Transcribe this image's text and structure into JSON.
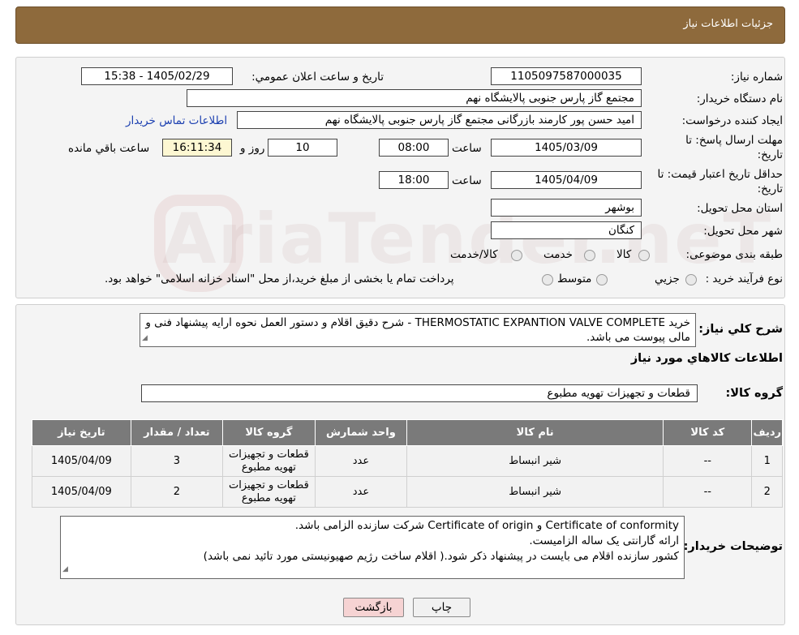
{
  "header": {
    "title": "جزئیات اطلاعات نیاز"
  },
  "details": {
    "need_number_label": "شماره نیاز:",
    "need_number": "1105097587000035",
    "announce_label": "تاریخ و ساعت اعلان عمومي:",
    "announce_value": "1405/02/29 - 15:38",
    "buyer_org_label": "نام دستگاه خريدار:",
    "buyer_org": "مجتمع گاز پارس جنوبی  پالایشگاه نهم",
    "creator_label": "ايجاد کننده درخواست:",
    "creator": "امید حسن پور کارمند بازرگانی مجتمع گاز پارس جنوبی  پالایشگاه نهم",
    "contact_link": "اطلاعات تماس خريدار",
    "deadline_label_1": "مهلت ارسال پاسخ: تا",
    "deadline_label_2": "تاريخ:",
    "deadline_date": "1405/03/09",
    "time_label": "ساعت",
    "deadline_time": "08:00",
    "days_value": "10",
    "days_label": "روز و",
    "remaining_time": "16:11:34",
    "remaining_label": "ساعت باقي مانده",
    "validity_label_1": "حداقل تاريخ اعتبار قيمت: تا",
    "validity_label_2": "تاريخ:",
    "validity_date": "1405/04/09",
    "validity_time": "18:00",
    "province_label": "استان محل تحويل:",
    "province": "بوشهر",
    "city_label": "شهر محل تحويل:",
    "city": "کنگان",
    "category_label": "طبقه بندی موضوعی:",
    "category_options": [
      "کالا",
      "خدمت",
      "کالا/خدمت"
    ],
    "purchase_type_label": "نوع فرآيند خريد :",
    "purchase_type_options": [
      "جزيي",
      "متوسط"
    ],
    "purchase_type_note": "پرداخت تمام يا بخشی از مبلغ خريد،از محل \"اسناد خزانه اسلامی\" خواهد بود."
  },
  "summary": {
    "label": "شرح کلي نياز:",
    "text": "خرید THERMOSTATIC EXPANTION VALVE COMPLETE - شرح دقیق اقلام و دستور العمل نحوه ارایه پیشنهاد فنی و مالی پیوست می باشد.",
    "items_title": "اطلاعات کالاهاي مورد نياز",
    "group_label": "گروه کالا:",
    "group_value": "قطعات و تجهیزات تهویه مطبوع"
  },
  "table": {
    "headers": [
      "رديف",
      "کد کالا",
      "نام کالا",
      "واحد شمارش",
      "گروه کالا",
      "تعداد / مقدار",
      "تاريخ نياز"
    ],
    "rows": [
      [
        "1",
        "--",
        "شیر انبساط",
        "عدد",
        "قطعات و تجهیزات تهویه مطبوع",
        "3",
        "1405/04/09"
      ],
      [
        "2",
        "--",
        "شیر انبساط",
        "عدد",
        "قطعات و تجهیزات تهویه مطبوع",
        "2",
        "1405/04/09"
      ]
    ]
  },
  "buyer_notes": {
    "label": "توضيحات خريدار:",
    "lines": [
      "Certificate of conformity و Certificate of origin شرکت سازنده الزامی باشد.",
      "ارائه گارانتی یک ساله الزامیست.",
      "کشور سازنده اقلام می بایست در پیشنهاد ذکر شود.( اقلام ساخت رژیم صهیونیستی مورد تائید نمی باشد)"
    ]
  },
  "buttons": {
    "print": "چاپ",
    "back": "بازگشت"
  },
  "watermark": "AriaTender.neT",
  "colors": {
    "header": "#8e6a3c",
    "table_header": "#7a7a7a",
    "remaining_bg": "#fdf7d2",
    "link": "#1b3fb0",
    "back_button": "#f6d3d3"
  }
}
